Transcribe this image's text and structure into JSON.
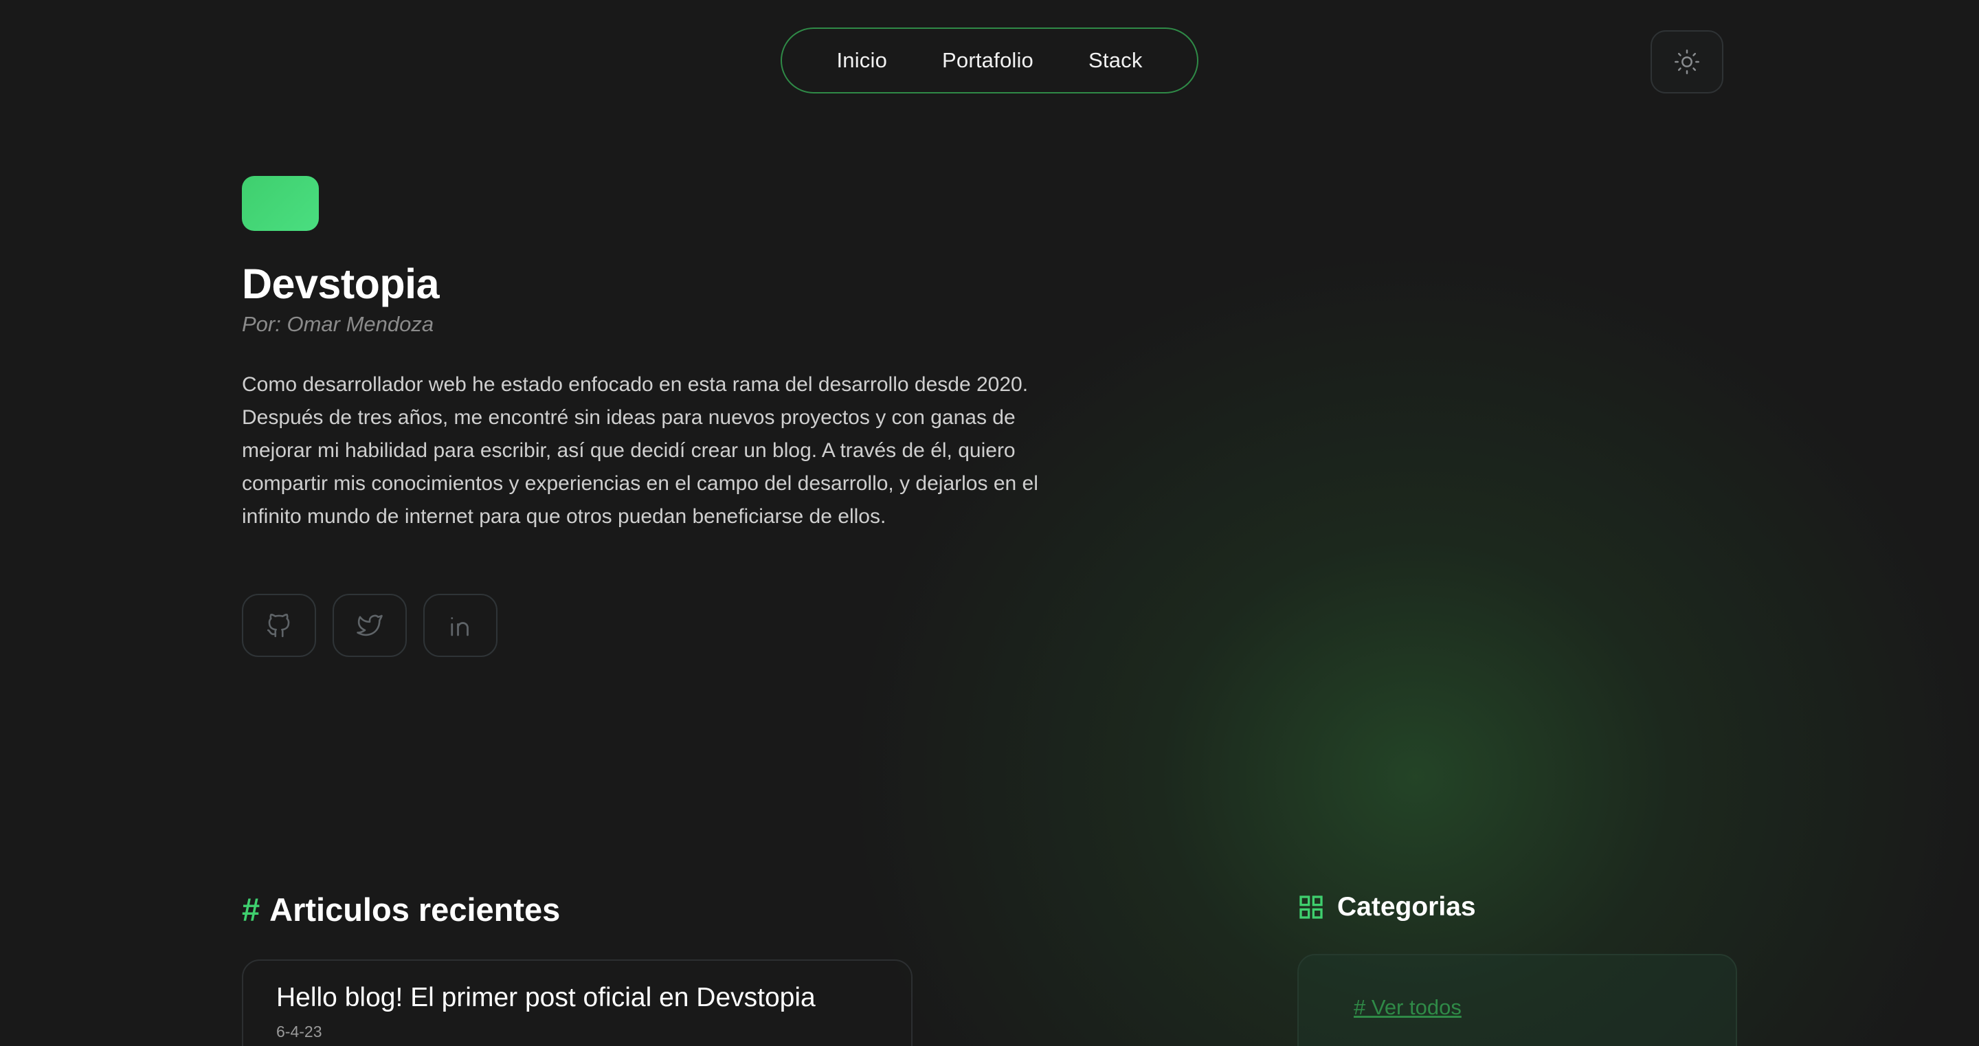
{
  "nav": {
    "items": [
      {
        "label": "Inicio"
      },
      {
        "label": "Portafolio"
      },
      {
        "label": "Stack"
      }
    ]
  },
  "theme_toggle": {
    "icon": "sun-icon"
  },
  "hero": {
    "title": "Devstopia",
    "author": "Por: Omar Mendoza",
    "intro": "Como desarrollador web he estado enfocado en esta rama del desarrollo desde 2020. Después de tres años, me encontré sin ideas para nuevos proyectos y con ganas de mejorar mi habilidad para escribir, así que decidí crear un blog. A través de él, quiero compartir mis conocimientos y experiencias en el campo del desarrollo, y dejarlos en el infinito mundo de internet para que otros puedan beneficiarse de ellos.",
    "socials": [
      {
        "icon": "github-icon"
      },
      {
        "icon": "twitter-icon"
      },
      {
        "icon": "linkedin-icon"
      }
    ]
  },
  "articles": {
    "hash": "#",
    "heading": "Articulos recientes",
    "items": [
      {
        "title": "Hello blog! El primer post oficial en Devstopia",
        "date": "6-4-23"
      }
    ]
  },
  "categories": {
    "heading": "Categorias",
    "link": "# Ver todos"
  },
  "colors": {
    "accent": "#4ade80",
    "background": "#191919",
    "nav_border": "#2f8a47"
  }
}
